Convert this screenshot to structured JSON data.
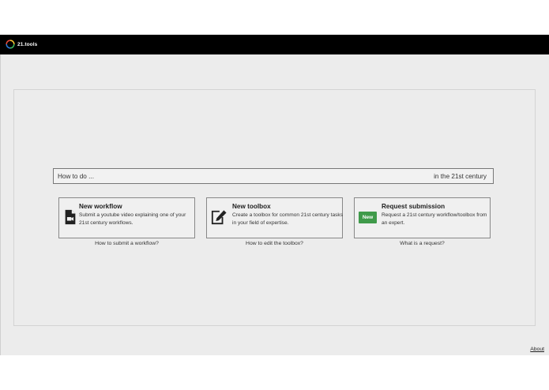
{
  "header": {
    "brand": "21.tools",
    "logo_colors": [
      "#f2c230",
      "#3bb35b",
      "#2a7bd6",
      "#e24a3b"
    ]
  },
  "search": {
    "prefix": "How to do  ...",
    "suffix": "in the 21st century"
  },
  "cards": [
    {
      "title": "New workflow",
      "description": "Submit a youtube video explaining one of your 21st century workflows.",
      "icon": "video-file-icon",
      "link": "How to submit a workflow?"
    },
    {
      "title": "New toolbox",
      "description": "Create a toolbox for common 21st century tasks in your field of expertise.",
      "icon": "edit-icon",
      "link": "How to edit the toolbox?"
    },
    {
      "title": "Request submission",
      "description": "Request a 21st century workflow/toolbox from an expert.",
      "badge": "New",
      "badge_color": "#3f9a4a",
      "link": "What is a request?"
    }
  ],
  "footer": {
    "about": "About"
  }
}
